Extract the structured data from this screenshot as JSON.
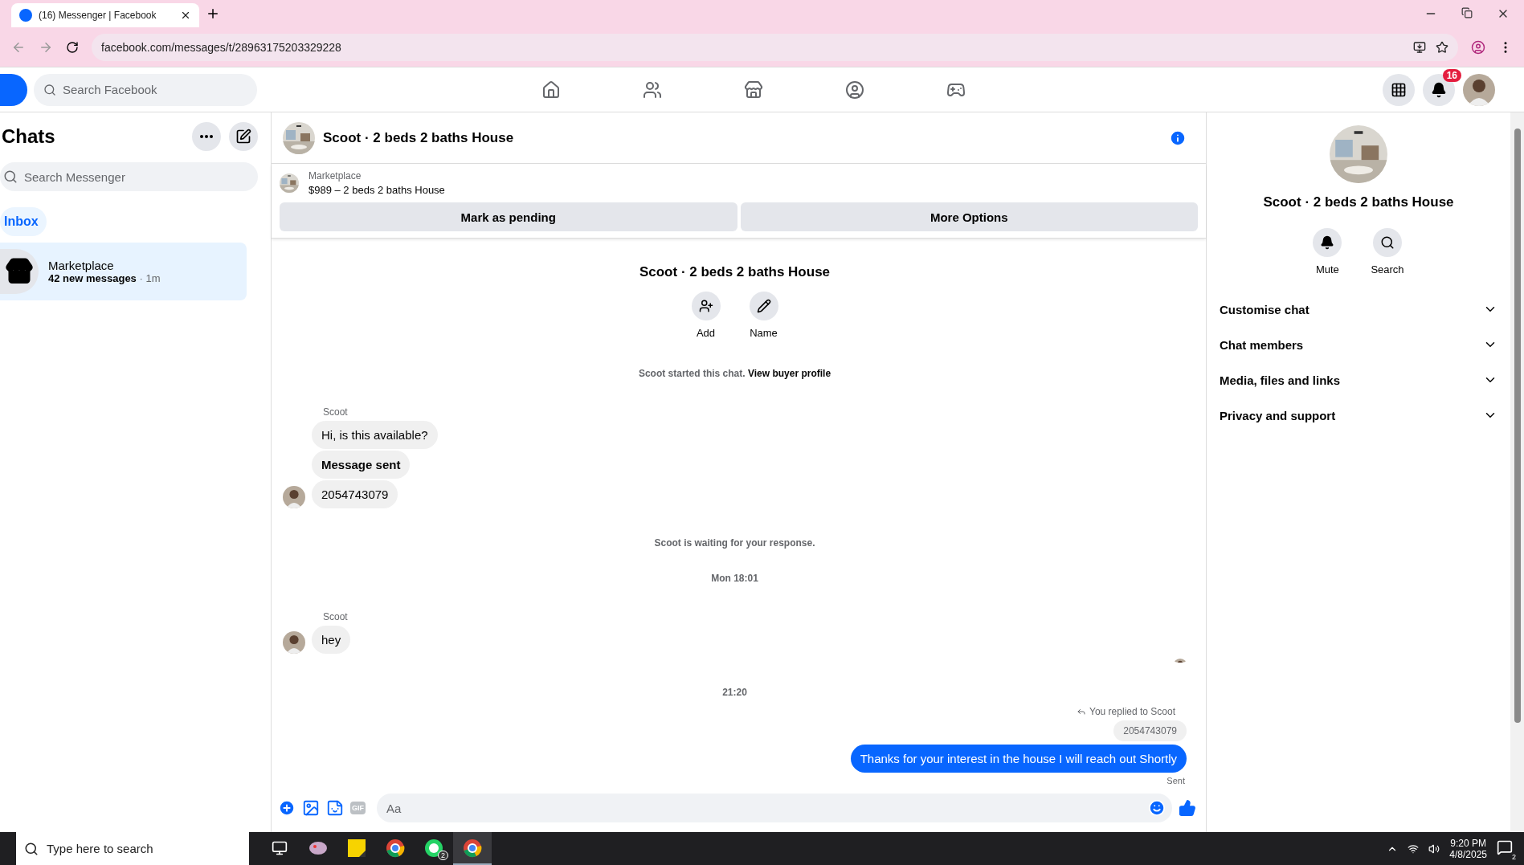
{
  "browser": {
    "tab_title": "(16) Messenger | Facebook",
    "url": "facebook.com/messages/t/28963175203329228"
  },
  "topbar": {
    "search_placeholder": "Search Facebook",
    "notification_count": "16"
  },
  "sidebar": {
    "title": "Chats",
    "search_placeholder": "Search Messenger",
    "filters": [
      {
        "label": "Inbox",
        "selected": true
      }
    ],
    "chats": [
      {
        "name": "Marketplace",
        "preview": "42 new messages",
        "time": "· 1m",
        "selected": true
      }
    ]
  },
  "chat": {
    "title": "Scoot · 2 beds 2 baths House",
    "listing": {
      "label": "Marketplace",
      "price_line": "$989 – 2 beds 2 baths House"
    },
    "actions": [
      "Mark as pending",
      "More Options"
    ],
    "profile": {
      "name": "Scoot · 2 beds 2 baths House",
      "actions": [
        {
          "kind": "add",
          "label": "Add"
        },
        {
          "kind": "name",
          "label": "Name"
        }
      ]
    },
    "timeline": [
      {
        "kind": "notice",
        "text": "Scoot started this chat.",
        "link": "View buyer profile"
      },
      {
        "kind": "group",
        "sender": "Scoot",
        "bubbles": [
          {
            "text": "Hi, is this available?",
            "bold": false
          },
          {
            "text": "Message sent",
            "bold": true
          },
          {
            "text": "2054743079",
            "bold": false
          }
        ]
      },
      {
        "kind": "notice",
        "text": "Scoot is waiting for your response."
      },
      {
        "kind": "time",
        "text": "Mon 18:01"
      },
      {
        "kind": "group",
        "sender": "Scoot",
        "bubbles": [
          {
            "text": "hey",
            "bold": false
          }
        ]
      },
      {
        "kind": "seen"
      },
      {
        "kind": "time",
        "text": "21:20"
      },
      {
        "kind": "reply",
        "reply_label": "You replied to Scoot",
        "quoted": "2054743079",
        "text": "Thanks for your interest in the house I will reach out Shortly",
        "status": "Sent"
      }
    ],
    "composer": {
      "placeholder": "Aa",
      "gif_label": "GIF"
    }
  },
  "details": {
    "name": "Scoot · 2 beds 2 baths House",
    "actions": [
      {
        "kind": "mute",
        "label": "Mute"
      },
      {
        "kind": "search",
        "label": "Search"
      }
    ],
    "sections": [
      {
        "label": "Customise chat",
        "expanded": false
      },
      {
        "label": "Chat members",
        "expanded": false
      },
      {
        "label": "Media, files and links",
        "expanded": false
      },
      {
        "label": "Privacy and support",
        "expanded": false
      }
    ]
  },
  "taskbar": {
    "search_placeholder": "Type here to search",
    "apps": [
      {
        "kind": "taskview"
      },
      {
        "kind": "paint"
      },
      {
        "kind": "notes"
      },
      {
        "kind": "chrome"
      },
      {
        "kind": "whatsapp",
        "badge": "2"
      },
      {
        "kind": "chrome2",
        "selected": true
      }
    ],
    "time": "9:20 PM",
    "date": "4/8/2025",
    "notifications": "2"
  }
}
